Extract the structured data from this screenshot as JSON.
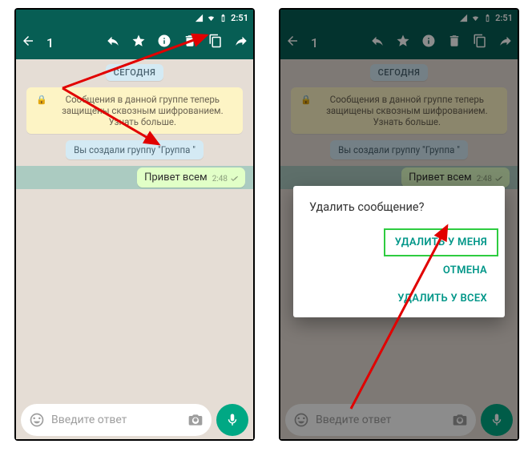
{
  "status": {
    "time": "2:51"
  },
  "topbar": {
    "selection_count": "1",
    "icons": {
      "back": "back-arrow-icon",
      "reply": "reply-icon",
      "star": "star-icon",
      "info": "info-icon",
      "delete": "trash-icon",
      "copy": "copy-icon",
      "forward": "forward-icon"
    }
  },
  "chat": {
    "date_label": "СЕГОДНЯ",
    "encryption_notice": "Сообщения в данной группе теперь защищены сквозным шифрованием. Узнать больше.",
    "system_message": "Вы создали группу \"Группа \"",
    "message": {
      "text": "Привет всем",
      "time": "2:48"
    }
  },
  "input": {
    "placeholder": "Введите ответ"
  },
  "dialog": {
    "title": "Удалить сообщение?",
    "action_delete_for_me": "УДАЛИТЬ У МЕНЯ",
    "action_cancel": "ОТМЕНА",
    "action_delete_for_all": "УДАЛИТЬ У ВСЕХ"
  }
}
